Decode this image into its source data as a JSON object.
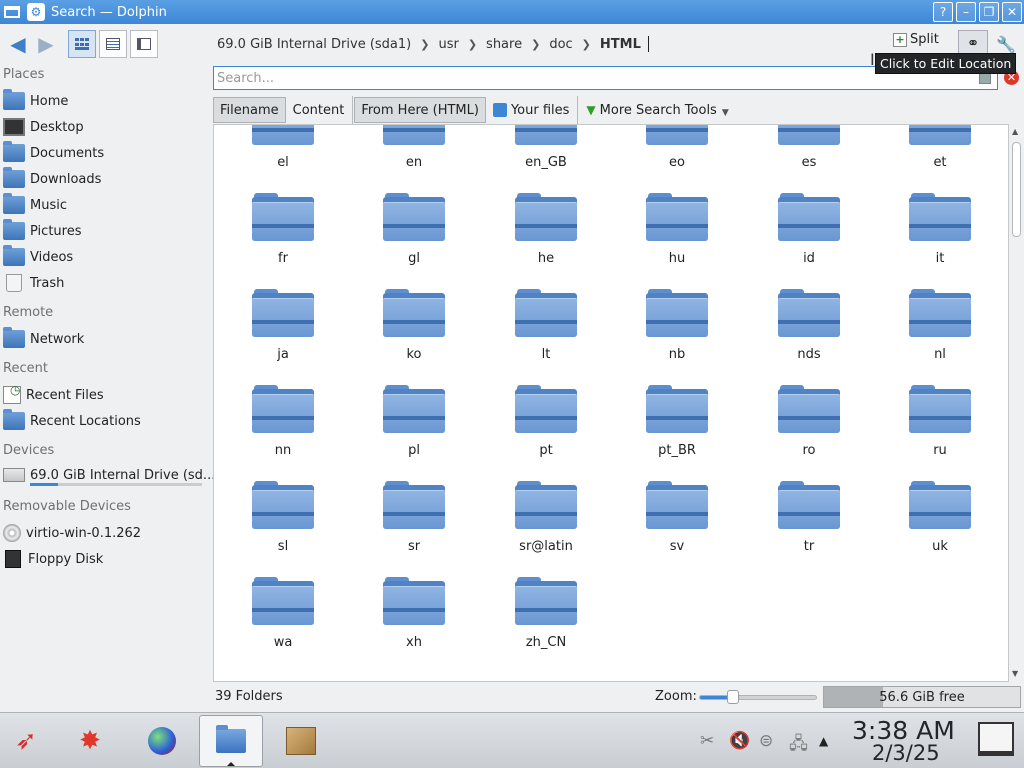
{
  "window": {
    "title": "Search — Dolphin",
    "buttons": {
      "help": "?",
      "minimize": "–",
      "maximize": "❐",
      "close": "✕"
    }
  },
  "toolbar": {
    "back_icon": "arrow-left-icon",
    "forward_icon": "arrow-right-icon",
    "split_label": "Split",
    "breadcrumb": [
      "69.0 GiB Internal Drive (sda1)",
      "usr",
      "share",
      "doc",
      "HTML"
    ],
    "tooltip": "Click to Edit Location"
  },
  "sidebar": {
    "sections": {
      "places": "Places",
      "remote": "Remote",
      "recent": "Recent",
      "devices": "Devices",
      "removable": "Removable Devices"
    },
    "places": [
      "Home",
      "Desktop",
      "Documents",
      "Downloads",
      "Music",
      "Pictures",
      "Videos",
      "Trash"
    ],
    "remote": [
      "Network"
    ],
    "recent": [
      "Recent Files",
      "Recent Locations"
    ],
    "devices": [
      "69.0 GiB Internal Drive (sd..."
    ],
    "removable": [
      "virtio-win-0.1.262",
      "Floppy Disk"
    ]
  },
  "search": {
    "placeholder": "Search...",
    "value": "",
    "filters": {
      "filename": "Filename",
      "content": "Content",
      "from_here": "From Here (HTML)",
      "your_files": "Your files",
      "more_tools": "More Search Tools"
    }
  },
  "folders": [
    "el",
    "en",
    "en_GB",
    "eo",
    "es",
    "et",
    "fr",
    "gl",
    "he",
    "hu",
    "id",
    "it",
    "ja",
    "ko",
    "lt",
    "nb",
    "nds",
    "nl",
    "nn",
    "pl",
    "pt",
    "pt_BR",
    "ro",
    "ru",
    "sl",
    "sr",
    "sr@latin",
    "sv",
    "tr",
    "uk",
    "wa",
    "xh",
    "zh_CN"
  ],
  "status": {
    "count": "39 Folders",
    "zoom_label": "Zoom:",
    "zoom_level": 0.28,
    "free_space": "56.6 GiB free"
  },
  "taskbar": {
    "time": "3:38 AM",
    "date": "2/3/25"
  },
  "colors": {
    "accent": "#3d86d6",
    "titlebar": "#4b94dd",
    "folder": "#6a97d2"
  }
}
